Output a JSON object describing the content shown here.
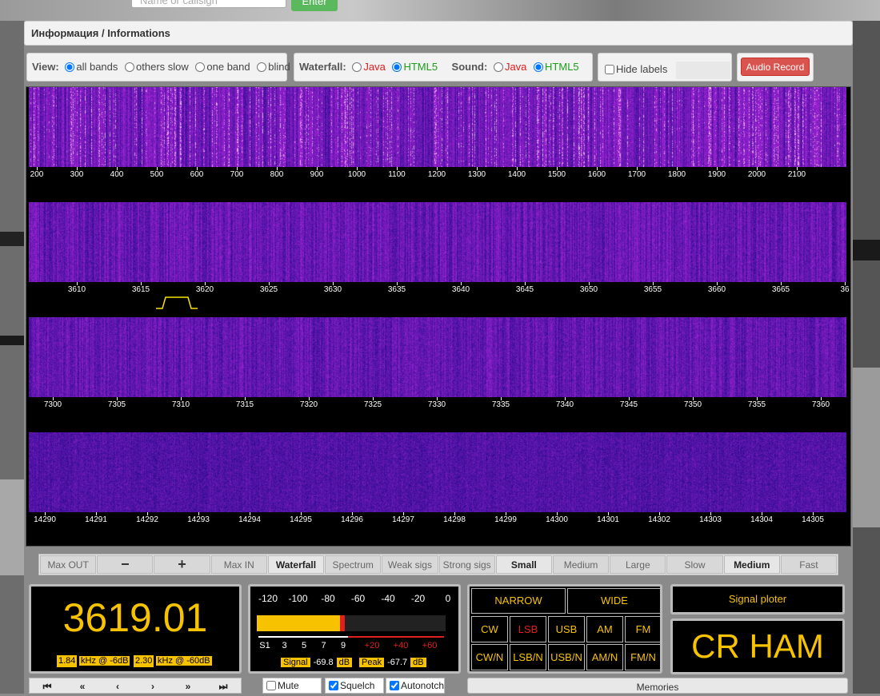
{
  "search": {
    "placeholder": "Name or callsign",
    "enter_label": "Enter"
  },
  "info_title": "Информация / Informations",
  "view": {
    "label": "View:",
    "options": [
      "all bands",
      "others slow",
      "one band",
      "blind"
    ],
    "selected": "all bands"
  },
  "waterfall": {
    "label": "Waterfall:",
    "java": "Java",
    "html5": "HTML5",
    "selected": "HTML5"
  },
  "sound": {
    "label": "Sound:",
    "java": "Java",
    "html5": "HTML5",
    "selected": "HTML5"
  },
  "hide_labels": "Hide labels",
  "audio_record": "Audio Record",
  "bands": [
    {
      "ticks": [
        "200",
        "300",
        "400",
        "500",
        "600",
        "700",
        "800",
        "900",
        "1000",
        "1100",
        "1200",
        "1300",
        "1400",
        "1500",
        "1600",
        "1700",
        "1800",
        "1900",
        "2000",
        "2100"
      ]
    },
    {
      "ticks": [
        "3610",
        "3615",
        "3620",
        "3625",
        "3630",
        "3635",
        "3640",
        "3645",
        "3650",
        "3655",
        "3660",
        "3665",
        "36"
      ]
    },
    {
      "ticks": [
        "7300",
        "7305",
        "7310",
        "7315",
        "7320",
        "7325",
        "7330",
        "7335",
        "7340",
        "7345",
        "7350",
        "7355",
        "7360"
      ]
    },
    {
      "ticks": [
        "14290",
        "14291",
        "14292",
        "14293",
        "14294",
        "14295",
        "14296",
        "14297",
        "14298",
        "14299",
        "14300",
        "14301",
        "14302",
        "14303",
        "14304",
        "14305"
      ]
    }
  ],
  "controls": [
    "Max OUT",
    "−",
    "+",
    "Max IN",
    "Waterfall",
    "Spectrum",
    "Weak sigs",
    "Strong sigs",
    "Small",
    "Medium",
    "Large",
    "Slow",
    "Medium",
    "Fast"
  ],
  "frequency": "3619.01",
  "bw1": {
    "value": "1.84",
    "label": "kHz @ -6dB"
  },
  "bw2": {
    "value": "2.30",
    "label": "kHz @ -60dB"
  },
  "smeter": {
    "scale_top": [
      "-120",
      "-100",
      "-80",
      "-60",
      "-40",
      "-20",
      "0"
    ],
    "scale_bottom_white": [
      "S1",
      "3",
      "5",
      "7",
      "9"
    ],
    "scale_bottom_red": [
      "+20",
      "+40",
      "+60"
    ],
    "level": 0.44,
    "signal_label": "Signal",
    "signal_value": "-69.8",
    "peak_label": "Peak",
    "peak_value": "-67.7",
    "unit": "dB"
  },
  "modes": {
    "narrow": "NARROW",
    "wide": "WIDE",
    "row1": [
      "CW",
      "LSB",
      "USB",
      "AM",
      "FM"
    ],
    "row2": [
      "CW/N",
      "LSB/N",
      "USB/N",
      "AM/N",
      "FM/N"
    ],
    "selected": "LSB"
  },
  "signal_ploter": "Signal ploter",
  "station": "CR HAM",
  "nav": [
    "⏮",
    "«",
    "‹",
    "›",
    "»",
    "⏭"
  ],
  "checks": {
    "mute": "Mute",
    "squelch": "Squelch",
    "autonotch": "Autonotch"
  },
  "memories": "Memories",
  "colors": {
    "accent": "#f7c300",
    "record": "#d9534f",
    "enter": "#5cb85c"
  }
}
